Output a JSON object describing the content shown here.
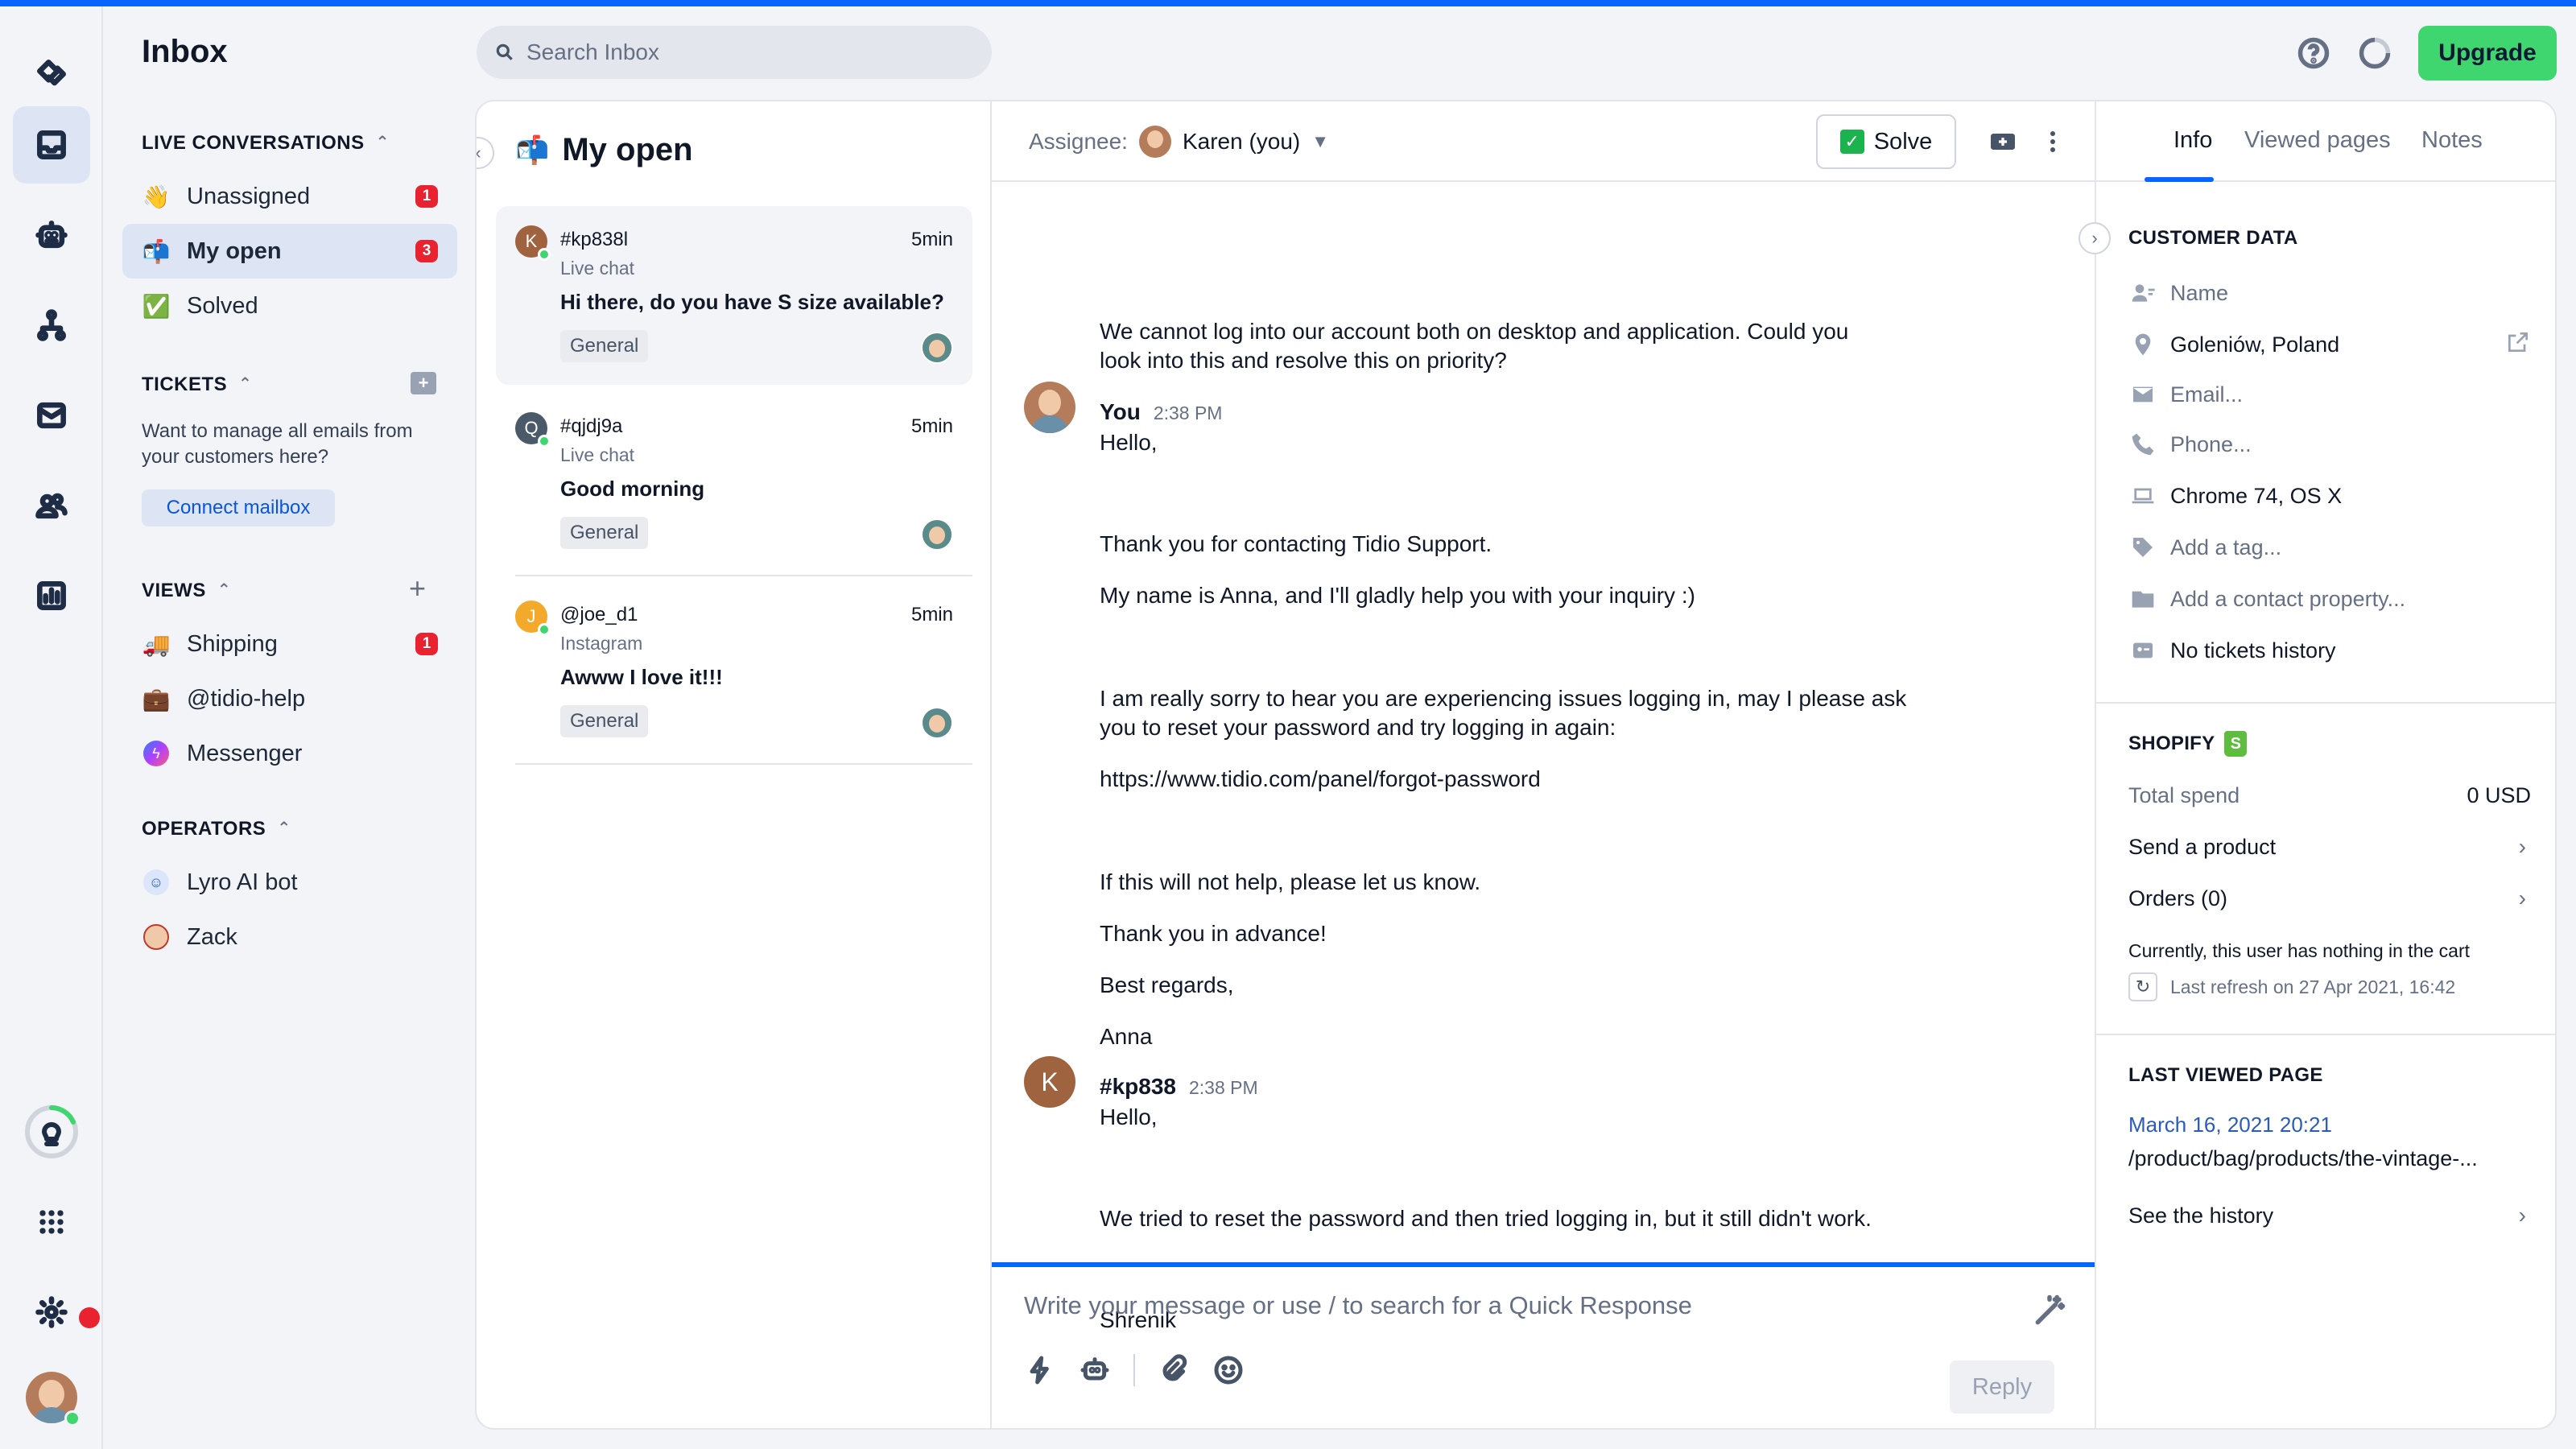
{
  "app": {
    "title": "Inbox",
    "search_placeholder": "Search Inbox",
    "upgrade_label": "Upgrade",
    "accent": "#0566ff",
    "upgrade_color": "#3fd66f"
  },
  "rail": {
    "items": [
      "workspace-icon",
      "inbox-icon",
      "bot-icon",
      "flows-icon",
      "mail-icon",
      "contacts-icon",
      "analytics-icon"
    ],
    "bottom": [
      "lightbulb-icon",
      "apps-grid-icon",
      "settings-icon",
      "user-avatar"
    ]
  },
  "nav": {
    "live_conversations": {
      "heading": "LIVE CONVERSATIONS",
      "items": [
        {
          "label": "Unassigned",
          "badge": "1",
          "icon": "👋"
        },
        {
          "label": "My open",
          "badge": "3",
          "icon": "📬"
        },
        {
          "label": "Solved",
          "badge": "",
          "icon": "✅"
        }
      ]
    },
    "tickets": {
      "heading": "TICKETS",
      "description": "Want to manage all emails from your customers here?",
      "connect_label": "Connect mailbox"
    },
    "views": {
      "heading": "VIEWS",
      "items": [
        {
          "label": "Shipping",
          "badge": "1",
          "icon": "🚚"
        },
        {
          "label": "@tidio-help",
          "badge": "",
          "icon": "💼"
        },
        {
          "label": "Messenger",
          "badge": "",
          "icon": "messenger"
        }
      ]
    },
    "operators": {
      "heading": "OPERATORS",
      "items": [
        {
          "label": "Lyro AI bot"
        },
        {
          "label": "Zack"
        }
      ]
    }
  },
  "list": {
    "title": "My open",
    "icon": "📬",
    "conversations": [
      {
        "id": "#kp838l",
        "initial": "K",
        "color": "#a0633f",
        "channel": "Live chat",
        "time": "5min",
        "message": "Hi there, do you have S size available?",
        "tag": "General"
      },
      {
        "id": "#qjdj9a",
        "initial": "Q",
        "color": "#4a5a68",
        "channel": "Live chat",
        "time": "5min",
        "message": "Good morning",
        "tag": "General"
      },
      {
        "id": "@joe_d1",
        "initial": "J",
        "color": "#f3a92a",
        "channel": "Instagram",
        "time": "5min",
        "message": "Awww I love it!!!",
        "tag": "General"
      }
    ]
  },
  "chat": {
    "assignee_label": "Assignee:",
    "assignee_name": "Karen (you)",
    "solve_label": "Solve",
    "lines": {
      "l1": "We cannot log into our account both on desktop and application. Could you",
      "l2": "look into this and resolve this on priority?",
      "you_name": "You",
      "you_time": "2:38 PM",
      "y1": "Hello,",
      "y2": "Thank you for contacting Tidio Support.",
      "y3": "My name is Anna, and I'll gladly help you with your inquiry :)",
      "y4": "I am really sorry to hear you are experiencing issues logging in, may I please ask",
      "y5": "you to reset your password and try logging in again:",
      "y6": "https://www.tidio.com/panel/forgot-password",
      "y7": "If this will not help, please let us know.",
      "y8": "Thank you in advance!",
      "y9": "Best regards,",
      "y10": "Anna",
      "cust_name": "#kp838",
      "cust_initial": "K",
      "cust_time": "2:38 PM",
      "c1": "Hello,",
      "c2": "We tried to reset the password and then tried logging in, but it still didn't work.",
      "c3": "Shrenik"
    },
    "composer_placeholder": "Write your message or use / to search for a Quick Response",
    "reply_label": "Reply"
  },
  "info": {
    "tabs": [
      "Info",
      "Viewed pages",
      "Notes"
    ],
    "customer_data_heading": "CUSTOMER DATA",
    "rows": {
      "name": "Name",
      "location": "Goleniów, Poland",
      "email": "Email...",
      "phone": "Phone...",
      "browser": "Chrome 74, OS X",
      "tag": "Add a tag...",
      "property": "Add a contact property...",
      "tickets": "No tickets history"
    },
    "shopify": {
      "heading": "SHOPIFY",
      "total_spend_label": "Total spend",
      "total_spend_value": "0 USD",
      "send_product": "Send a product",
      "orders": "Orders (0)",
      "cart_note": "Currently, this user has nothing in the cart",
      "last_refresh": "Last refresh on 27 Apr 2021, 16:42"
    },
    "last_viewed": {
      "heading": "LAST VIEWED PAGE",
      "date": "March 16, 2021 20:21",
      "path": "/product/bag/products/the-vintage-...",
      "history_label": "See the history"
    }
  }
}
